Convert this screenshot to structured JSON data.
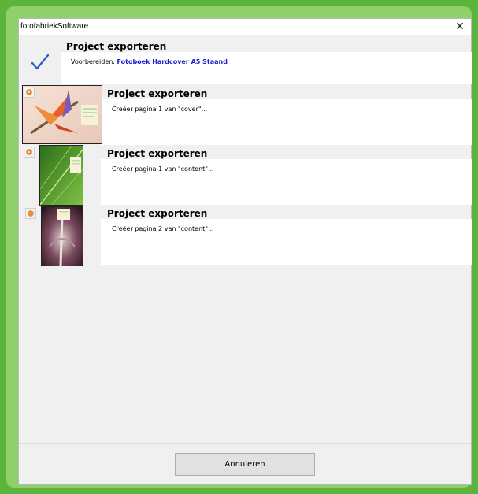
{
  "window": {
    "title": "fotofabriekSoftware",
    "close_glyph": "✕"
  },
  "prepare": {
    "heading": "Project exporteren",
    "label": "Voorbereiden: ",
    "product": "Fotoboek Hardcover A5 Staand",
    "icon": "checkmark-icon"
  },
  "jobs": [
    {
      "heading": "Project exporteren",
      "message": "Creëer pagina 1 van \"cover\"...",
      "thumb": "orange-flower-cover"
    },
    {
      "heading": "Project exporteren",
      "message": "Creëer pagina 1 van \"content\"...",
      "thumb": "green-leaf-page"
    },
    {
      "heading": "Project exporteren",
      "message": "Creëer pagina 2 van \"content\"...",
      "thumb": "purple-flower-page"
    }
  ],
  "footer": {
    "cancel_label": "Annuleren"
  },
  "colors": {
    "background_green": "#5cb53a",
    "accent_blue": "#1a1acc",
    "check_blue": "#2e62c9"
  }
}
